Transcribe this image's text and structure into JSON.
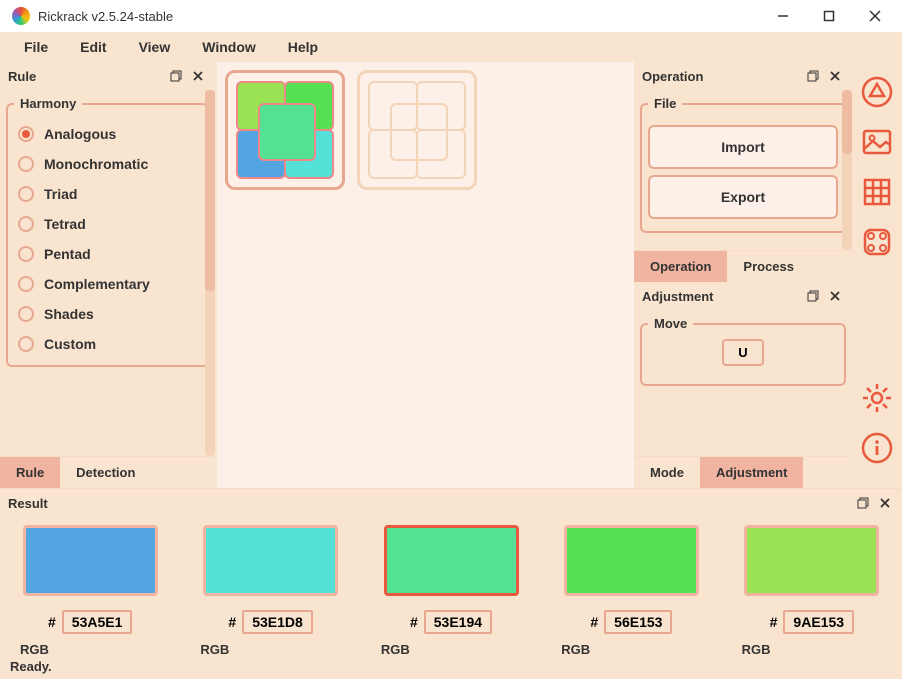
{
  "window": {
    "title": "Rickrack v2.5.24-stable"
  },
  "menu": {
    "file": "File",
    "edit": "Edit",
    "view": "View",
    "window": "Window",
    "help": "Help"
  },
  "rule_panel": {
    "title": "Rule",
    "group_label": "Harmony",
    "options": [
      "Analogous",
      "Monochromatic",
      "Triad",
      "Tetrad",
      "Pentad",
      "Complementary",
      "Shades",
      "Custom"
    ],
    "selected": 0,
    "tabs": {
      "rule": "Rule",
      "detection": "Detection"
    }
  },
  "operation_panel": {
    "title": "Operation",
    "file_group": "File",
    "import_btn": "Import",
    "export_btn": "Export",
    "tabs": {
      "operation": "Operation",
      "process": "Process"
    }
  },
  "adjustment_panel": {
    "title": "Adjustment",
    "move_group": "Move",
    "u_btn": "U",
    "tabs": {
      "mode": "Mode",
      "adjustment": "Adjustment"
    }
  },
  "result_panel": {
    "title": "Result",
    "rgb_label": "RGB",
    "hash": "#",
    "colors": [
      {
        "hex": "53A5E1",
        "rgb": "#53A5E1",
        "active": false
      },
      {
        "hex": "53E1D8",
        "rgb": "#53E1D8",
        "active": false
      },
      {
        "hex": "53E194",
        "rgb": "#53E194",
        "active": true
      },
      {
        "hex": "56E153",
        "rgb": "#56E153",
        "active": false
      },
      {
        "hex": "9AE153",
        "rgb": "#9AE153",
        "active": false
      }
    ]
  },
  "swatch_colors": {
    "c1": "#9AE153",
    "c2": "#56E153",
    "c3": "#53A5E1",
    "c4": "#53E1D8",
    "c5": "#53E194"
  },
  "status": "Ready."
}
